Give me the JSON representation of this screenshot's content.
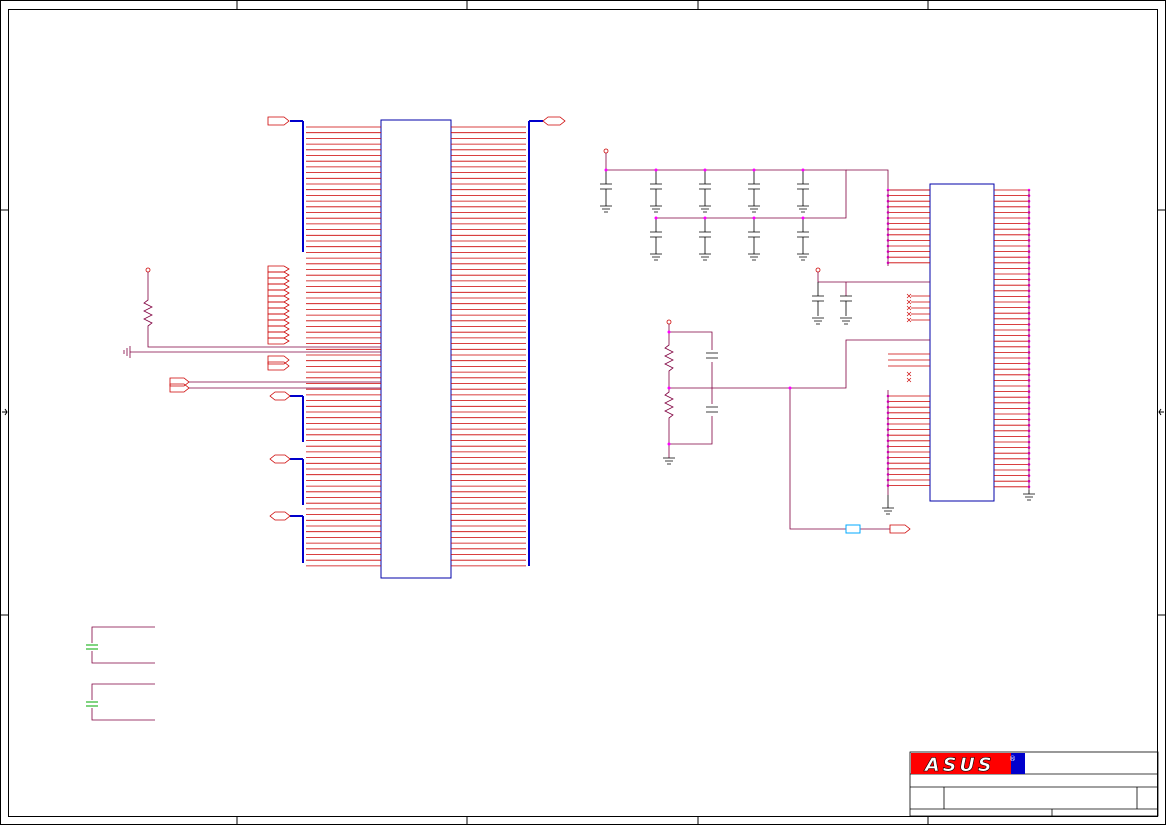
{
  "title_block": {
    "logo_text": "ASUS",
    "registered_mark": "®",
    "brand_color": "#ff0000",
    "brand_accent": "#0000cc"
  },
  "colors": {
    "frame": "#000000",
    "wire_red": "#cc0000",
    "wire_maroon": "#800040",
    "bus_blue": "#0000cc",
    "component_blue": "#0000aa",
    "junction": "#ff00ff",
    "cap_green": "#00aa00",
    "ferrite_cyan": "#00aaff"
  }
}
